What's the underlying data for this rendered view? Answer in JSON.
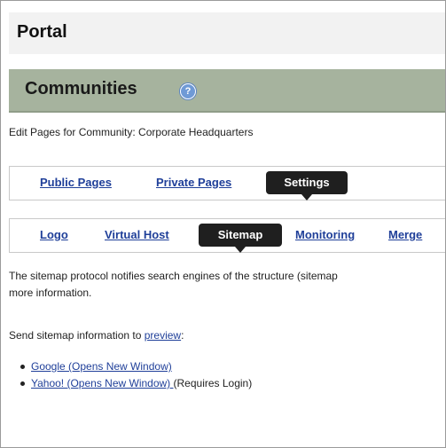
{
  "portal": {
    "title": "Portal"
  },
  "community": {
    "title": "Communities",
    "help_icon": "help-icon"
  },
  "edit_label": "Edit Pages for Community: Corporate Headquarters",
  "page_tabs": {
    "items": [
      {
        "label": "Public Pages",
        "active": false
      },
      {
        "label": "Private Pages",
        "active": false
      },
      {
        "label": "Settings",
        "active": true
      }
    ]
  },
  "settings_tabs": {
    "items": [
      {
        "label": "Logo",
        "active": false
      },
      {
        "label": "Virtual Host",
        "active": false
      },
      {
        "label": "Sitemap",
        "active": true
      },
      {
        "label": "Monitoring",
        "active": false
      },
      {
        "label": "Merge",
        "active": false
      }
    ]
  },
  "description": {
    "line1": "The sitemap protocol notifies search engines of the structure (sitemap",
    "line2": "more information."
  },
  "send": {
    "prefix": "Send sitemap information to ",
    "link": "preview",
    "suffix": ":"
  },
  "engines": [
    {
      "link": "Google (Opens New Window)",
      "note": ""
    },
    {
      "link": "Yahoo! (Opens New Window) ",
      "note": "(Requires Login)"
    }
  ],
  "colors": {
    "header_bg": "#a6b39e",
    "link": "#1f3f99",
    "active_tab": "#1f1f1f"
  }
}
